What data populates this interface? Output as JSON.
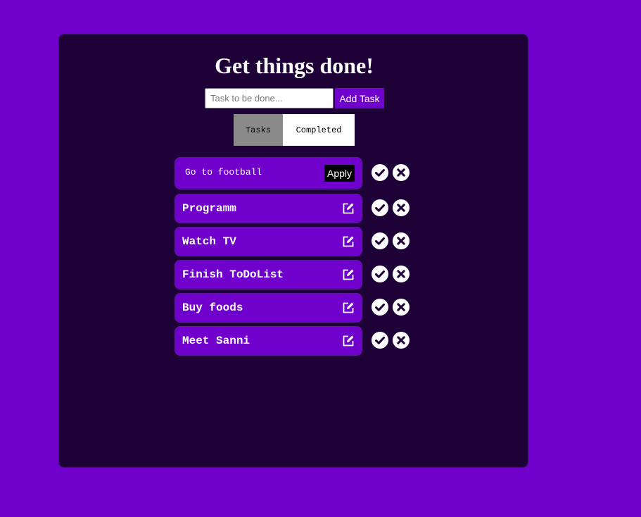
{
  "header": {
    "title": "Get things done!"
  },
  "new_task": {
    "placeholder": "Task to be done...",
    "value": "",
    "add_label": "Add Task"
  },
  "tabs": [
    {
      "label": "Tasks",
      "active": true
    },
    {
      "label": "Completed",
      "active": false
    }
  ],
  "editing": {
    "value": "Go to football",
    "apply_label": "Apply"
  },
  "tasks": [
    {
      "text": "Programm"
    },
    {
      "text": "Watch TV"
    },
    {
      "text": "Finish ToDoList"
    },
    {
      "text": "Buy foods"
    },
    {
      "text": "Meet Sanni"
    }
  ],
  "icons": {
    "edit": "edit-icon",
    "complete": "check-circle-icon",
    "delete": "close-circle-icon"
  },
  "colors": {
    "background": "#7000cc",
    "panel": "#1d0137",
    "accent": "#7000cc",
    "active_tab": "#8a8a8a"
  }
}
